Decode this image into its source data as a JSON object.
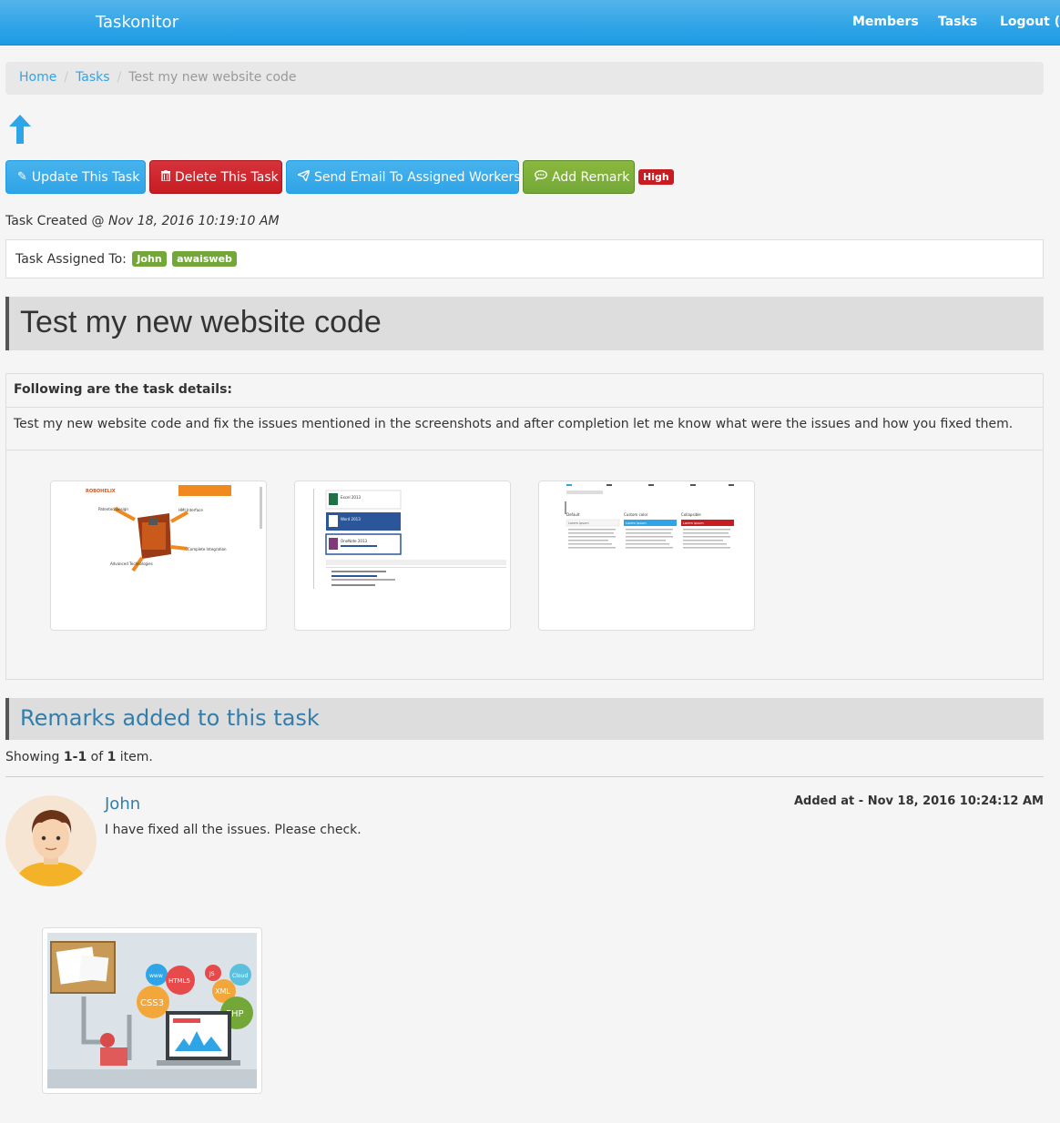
{
  "navbar": {
    "brand": "Taskonitor",
    "links": [
      "Members",
      "Tasks",
      "Logout (St"
    ]
  },
  "breadcrumb": {
    "items": [
      "Home",
      "Tasks"
    ],
    "active": "Test my new website code"
  },
  "actions": {
    "update": "Update This Task",
    "delete": "Delete This Task",
    "email": "Send Email To Assigned Workers",
    "remark": "Add Remark",
    "priority": "High"
  },
  "task": {
    "created_label": "Task Created @",
    "created_at": "Nov 18, 2016 10:19:10 AM",
    "assigned_label": "Task Assigned To:",
    "assignees": [
      "John",
      "awaisweb"
    ],
    "title": "Test my new website code",
    "details_heading": "Following are the task details:",
    "description": "Test my new website code and fix the issues mentioned in the screenshots and after completion let me know what were the issues and how you fixed them.",
    "screenshot_texts": {
      "shot1": [
        "ROBOHELIX",
        "Patented Design",
        "HMI Interface",
        "Complete Integration",
        "Advanced Technologies"
      ],
      "shot2": [
        "Excel 2013",
        "Word 2013",
        "OneNote 2013"
      ],
      "shot3": [
        "Default",
        "Custom color",
        "Collapsible",
        "Lorem ipsum"
      ]
    }
  },
  "remarks": {
    "heading": "Remarks added to this task",
    "summary_prefix": "Showing",
    "summary_range": "1-1",
    "summary_of": "of",
    "summary_total": "1",
    "summary_suffix": "item.",
    "items": [
      {
        "author": "John",
        "date": "Added at - Nov 18, 2016 10:24:12 AM",
        "text": "I have fixed all the issues. Please check.",
        "image_labels": [
          "www",
          "HTML5",
          "JS",
          "Cloud",
          "XML",
          "CSS3",
          "PHP"
        ]
      }
    ]
  },
  "colors": {
    "primary": "#2fa4e7",
    "danger": "#c71c22",
    "success": "#73a839",
    "link": "#317eac"
  }
}
